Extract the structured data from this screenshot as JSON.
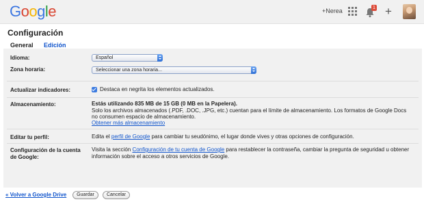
{
  "header": {
    "logo_letters": [
      {
        "ch": "G",
        "color": "#3b76e1"
      },
      {
        "ch": "o",
        "color": "#d9432f"
      },
      {
        "ch": "o",
        "color": "#f4b400"
      },
      {
        "ch": "g",
        "color": "#3b76e1"
      },
      {
        "ch": "l",
        "color": "#2f9e44"
      },
      {
        "ch": "e",
        "color": "#d9432f"
      }
    ],
    "user_link": "+Nerea",
    "notification_count": "1",
    "apps_icon": "apps-grid-icon",
    "bell_icon": "bell-icon",
    "plus_icon": "plus-icon"
  },
  "page": {
    "title": "Configuración",
    "tabs": [
      "General",
      "Edición"
    ]
  },
  "settings": {
    "language": {
      "label": "Idioma:",
      "value": "Español"
    },
    "timezone": {
      "label": "Zona horaria:",
      "value": "Seleccionar una zona horaria..."
    },
    "indicators": {
      "label": "Actualizar indicadores:",
      "text": "Destaca en negrita los elementos actualizados.",
      "checked": true
    },
    "storage": {
      "label": "Almacenamiento:",
      "usage": "Estás utilizando 835 MB de 15 GB (0 MB en la Papelera).",
      "note_line1": "Solo los archivos almacenados (.PDF, .DOC, .JPG, etc.) cuentan para el límite de almacenamiento. Los formatos de Google Docs",
      "note_line2": "no consumen espacio de almacenamiento.",
      "link": "Obtener más almacenamiento"
    },
    "profile": {
      "label": "Editar tu perfil:",
      "before": "Edita el ",
      "link": "perfil de Google",
      "after": " para cambiar tu seudónimo, el lugar donde vives y otras opciones de configuración."
    },
    "account": {
      "label_line1": "Configuración de la cuenta",
      "label_line2": "de Google:",
      "before": "Visita la sección ",
      "link": "Configuración de tu cuenta de Google",
      "after": " para restablecer la contraseña, cambiar la pregunta de seguridad u obtener",
      "line2": "información sobre el acceso a otros servicios de Google."
    }
  },
  "footer": {
    "back_link": "« Volver a Google Drive",
    "save": "Guardar",
    "cancel": "Cancelar"
  }
}
